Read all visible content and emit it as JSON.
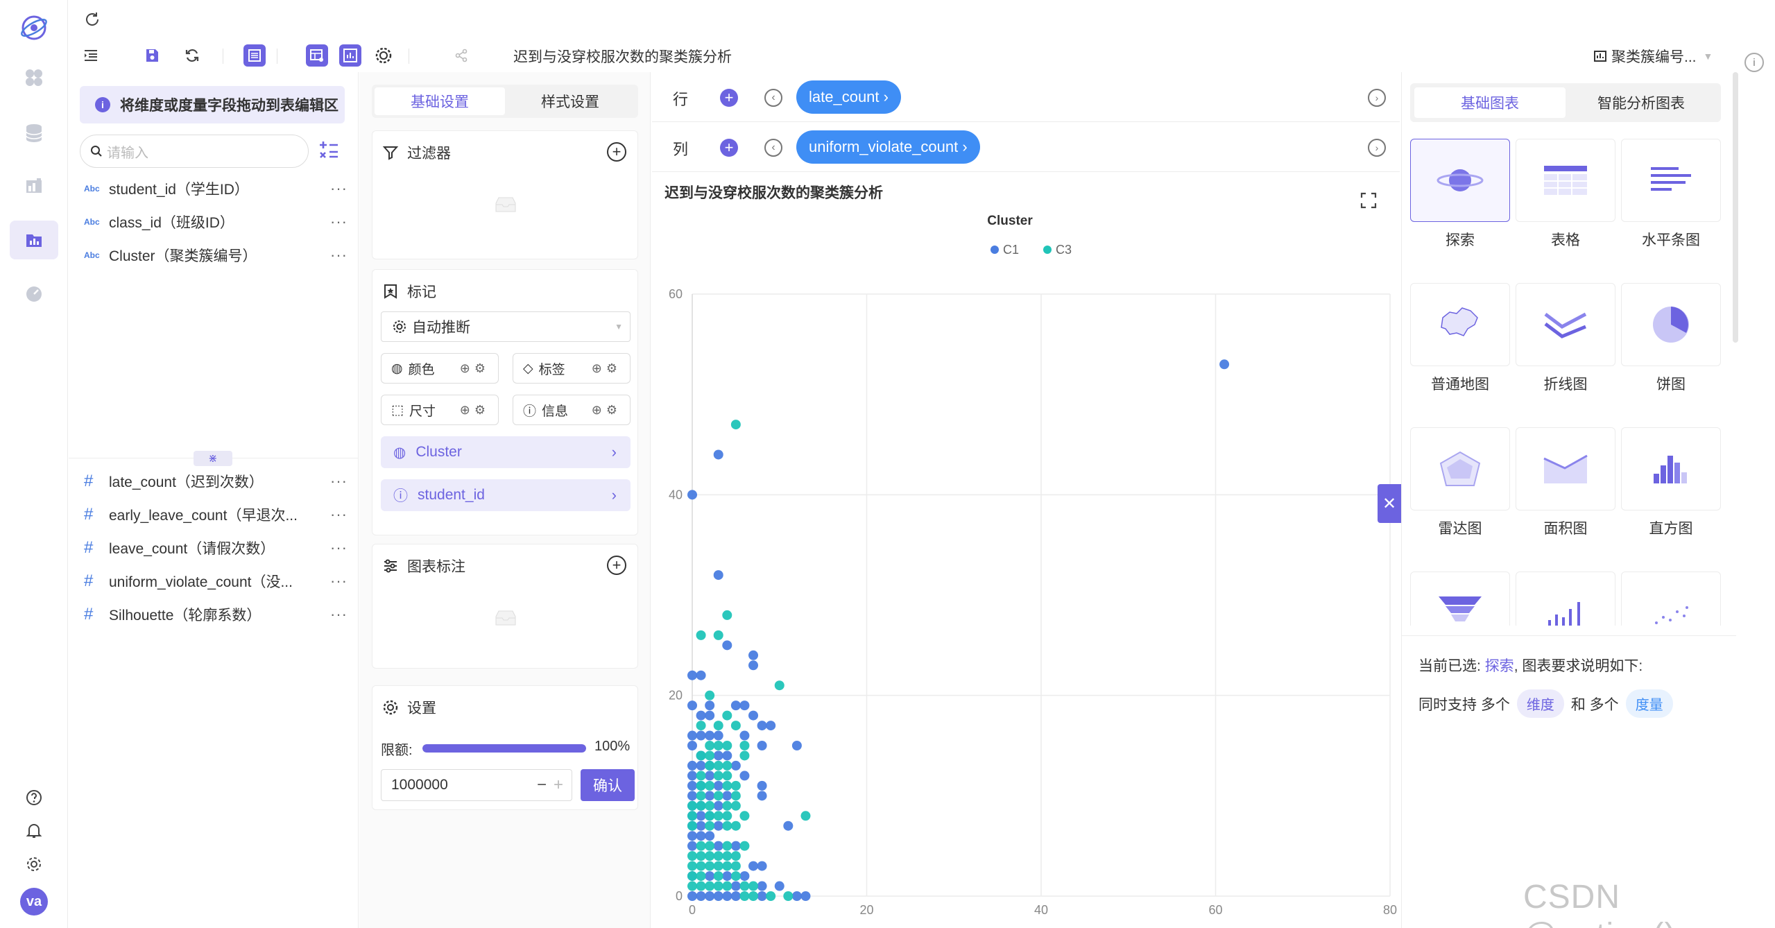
{
  "window": {
    "title": "迟到与没穿校服次数的聚类簇分析"
  },
  "toolbar": {
    "title": "迟到与没穿校服次数的聚类簇分析",
    "view_selector": "聚类簇编号..."
  },
  "rail": {
    "avatar": "va"
  },
  "field_panel": {
    "hint": "将维度或度量字段拖动到表编辑区",
    "search_placeholder": "请输入",
    "dimensions": [
      {
        "type": "Abc",
        "label": "student_id（学生ID）"
      },
      {
        "type": "Abc",
        "label": "class_id（班级ID）"
      },
      {
        "type": "Abc",
        "label": "Cluster（聚类簇编号）"
      }
    ],
    "measures": [
      {
        "type": "#",
        "label": "late_count（迟到次数）"
      },
      {
        "type": "#",
        "label": "early_leave_count（早退次..."
      },
      {
        "type": "#",
        "label": "leave_count（请假次数）"
      },
      {
        "type": "#",
        "label": "uniform_violate_count（没..."
      },
      {
        "type": "#",
        "label": "Silhouette（轮廓系数）"
      }
    ],
    "more": "···"
  },
  "settings": {
    "tabs": [
      "基础设置",
      "样式设置"
    ],
    "filter_title": "过滤器",
    "marks_title": "标记",
    "mark_type": "自动推断",
    "mark_buttons": [
      "颜色",
      "标签",
      "尺寸",
      "信息"
    ],
    "mark_fields": [
      {
        "label": "Cluster",
        "icon": "palette-icon"
      },
      {
        "label": "student_id",
        "icon": "info-icon"
      }
    ],
    "annotation_title": "图表标注",
    "config_title": "设置",
    "limit_label": "限额:",
    "limit_fraction": 1.0,
    "limit_percent": "100%",
    "limit_value": "1000000",
    "confirm": "确认"
  },
  "shelves": {
    "row_label": "行",
    "row_field": "late_count ›",
    "col_label": "列",
    "col_field": "uniform_violate_count ›"
  },
  "chart_data": {
    "type": "scatter",
    "title": "迟到与没穿校服次数的聚类簇分析",
    "legend_title": "Cluster",
    "legend_position": "top-center",
    "xlim": [
      0,
      80
    ],
    "ylim": [
      0,
      60
    ],
    "x_ticks": [
      "0",
      "20",
      "40",
      "60",
      "80"
    ],
    "y_ticks": [
      "0",
      "20",
      "40",
      "60"
    ],
    "grid": true,
    "series": [
      {
        "name": "C1",
        "color": "#4a7de0",
        "points": [
          [
            61,
            53
          ],
          [
            3,
            44
          ],
          [
            0,
            40
          ],
          [
            3,
            32
          ],
          [
            0,
            22
          ],
          [
            1,
            22
          ],
          [
            4,
            25
          ],
          [
            7,
            24
          ],
          [
            7,
            23
          ],
          [
            0,
            19
          ],
          [
            2,
            19
          ],
          [
            1,
            18
          ],
          [
            2,
            18
          ],
          [
            5,
            19
          ],
          [
            6,
            19
          ],
          [
            7,
            18
          ],
          [
            8,
            17
          ],
          [
            9,
            17
          ],
          [
            0,
            16
          ],
          [
            1,
            16
          ],
          [
            2,
            16
          ],
          [
            3,
            16
          ],
          [
            6,
            16
          ],
          [
            8,
            15
          ],
          [
            12,
            15
          ],
          [
            0,
            15
          ],
          [
            1,
            14
          ],
          [
            3,
            14
          ],
          [
            4,
            14
          ],
          [
            0,
            13
          ],
          [
            1,
            13
          ],
          [
            2,
            13
          ],
          [
            5,
            13
          ],
          [
            0,
            12
          ],
          [
            2,
            12
          ],
          [
            6,
            12
          ],
          [
            0,
            11
          ],
          [
            1,
            11
          ],
          [
            3,
            11
          ],
          [
            8,
            11
          ],
          [
            0,
            10
          ],
          [
            2,
            10
          ],
          [
            4,
            10
          ],
          [
            8,
            10
          ],
          [
            0,
            9
          ],
          [
            1,
            9
          ],
          [
            3,
            9
          ],
          [
            0,
            8
          ],
          [
            1,
            8
          ],
          [
            2,
            8
          ],
          [
            0,
            7
          ],
          [
            1,
            7
          ],
          [
            3,
            7
          ],
          [
            11,
            7
          ],
          [
            0,
            6
          ],
          [
            1,
            6
          ],
          [
            2,
            6
          ],
          [
            0,
            5
          ],
          [
            3,
            5
          ],
          [
            5,
            5
          ],
          [
            7,
            3
          ],
          [
            8,
            3
          ],
          [
            0,
            2
          ],
          [
            2,
            2
          ],
          [
            4,
            2
          ],
          [
            6,
            2
          ],
          [
            5,
            1
          ],
          [
            8,
            1
          ],
          [
            10,
            1
          ],
          [
            0,
            0
          ],
          [
            1,
            0
          ],
          [
            2,
            0
          ],
          [
            3,
            0
          ],
          [
            4,
            0
          ],
          [
            5,
            0
          ],
          [
            8,
            0
          ],
          [
            12,
            0
          ],
          [
            13,
            0
          ]
        ]
      },
      {
        "name": "C3",
        "color": "#20c4b8",
        "points": [
          [
            5,
            47
          ],
          [
            1,
            26
          ],
          [
            3,
            26
          ],
          [
            4,
            28
          ],
          [
            10,
            21
          ],
          [
            2,
            20
          ],
          [
            4,
            18
          ],
          [
            3,
            17
          ],
          [
            1,
            17
          ],
          [
            5,
            17
          ],
          [
            2,
            15
          ],
          [
            3,
            15
          ],
          [
            4,
            15
          ],
          [
            6,
            15
          ],
          [
            1,
            14
          ],
          [
            2,
            14
          ],
          [
            6,
            14
          ],
          [
            2,
            13
          ],
          [
            3,
            13
          ],
          [
            4,
            13
          ],
          [
            1,
            12
          ],
          [
            3,
            12
          ],
          [
            4,
            12
          ],
          [
            1,
            11
          ],
          [
            2,
            11
          ],
          [
            4,
            11
          ],
          [
            5,
            11
          ],
          [
            1,
            10
          ],
          [
            3,
            10
          ],
          [
            5,
            10
          ],
          [
            13,
            8
          ],
          [
            1,
            9
          ],
          [
            2,
            9
          ],
          [
            4,
            9
          ],
          [
            5,
            9
          ],
          [
            0,
            9
          ],
          [
            2,
            8
          ],
          [
            3,
            8
          ],
          [
            4,
            8
          ],
          [
            6,
            8
          ],
          [
            0,
            8
          ],
          [
            2,
            7
          ],
          [
            4,
            7
          ],
          [
            5,
            7
          ],
          [
            0,
            7
          ],
          [
            1,
            5
          ],
          [
            2,
            5
          ],
          [
            4,
            5
          ],
          [
            6,
            5
          ],
          [
            0,
            4
          ],
          [
            1,
            4
          ],
          [
            2,
            4
          ],
          [
            3,
            4
          ],
          [
            4,
            4
          ],
          [
            5,
            4
          ],
          [
            0,
            3
          ],
          [
            1,
            3
          ],
          [
            2,
            3
          ],
          [
            3,
            3
          ],
          [
            4,
            3
          ],
          [
            5,
            3
          ],
          [
            0,
            2
          ],
          [
            1,
            2
          ],
          [
            3,
            2
          ],
          [
            5,
            2
          ],
          [
            1,
            1
          ],
          [
            2,
            1
          ],
          [
            3,
            1
          ],
          [
            4,
            1
          ],
          [
            6,
            1
          ],
          [
            7,
            1
          ],
          [
            0,
            1
          ],
          [
            6,
            0
          ],
          [
            7,
            0
          ],
          [
            9,
            0
          ],
          [
            11,
            0
          ]
        ]
      }
    ]
  },
  "chart_panel": {
    "tabs": [
      "基础图表",
      "智能分析图表"
    ],
    "types": [
      "探索",
      "表格",
      "水平条图",
      "普通地图",
      "折线图",
      "饼图",
      "雷达图",
      "面积图",
      "直方图"
    ],
    "selected_prefix": "当前已选:",
    "selected_name": "探索",
    "selected_suffix": ", 图表要求说明如下:",
    "req_prefix": "同时支持 多个",
    "req_dim": "维度",
    "req_mid": "和 多个",
    "req_measure": "度量"
  },
  "watermark": "CSDN @potion()",
  "colors": {
    "accent": "#6c63e0",
    "pill": "#3f8ef5",
    "c1": "#4a7de0",
    "c3": "#20c4b8"
  }
}
